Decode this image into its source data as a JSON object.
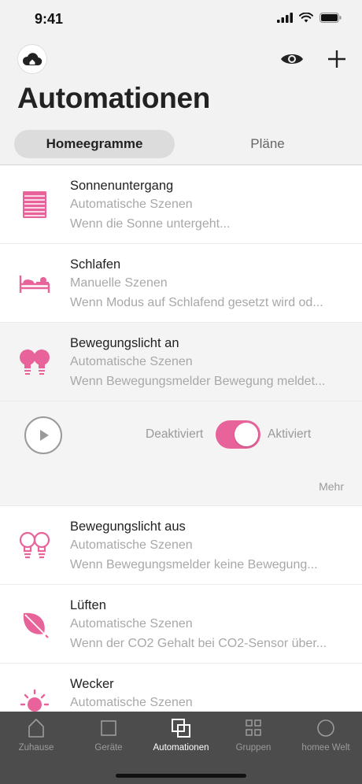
{
  "status_bar": {
    "time": "9:41"
  },
  "header": {
    "title": "Automationen"
  },
  "segments": [
    {
      "label": "Homeegramme",
      "active": true
    },
    {
      "label": "Pläne",
      "active": false
    }
  ],
  "automations": [
    {
      "title": "Sonnenuntergang",
      "type": "Automatische Szenen",
      "description": "Wenn die Sonne untergeht...",
      "icon": "blinds-icon"
    },
    {
      "title": "Schlafen",
      "type": "Manuelle Szenen",
      "description": "Wenn Modus auf Schlafend gesetzt wird od...",
      "icon": "bed-icon"
    },
    {
      "title": "Bewegungslicht an",
      "type": "Automatische Szenen",
      "description": "Wenn Bewegungsmelder Bewegung meldet...",
      "icon": "bulbs-filled-icon"
    },
    {
      "title": "Bewegungslicht aus",
      "type": "Automatische Szenen",
      "description": "Wenn Bewegungsmelder keine Bewegung...",
      "icon": "bulbs-outline-icon"
    },
    {
      "title": "Lüften",
      "type": "Automatische Szenen",
      "description": "Wenn der CO2 Gehalt bei CO2-Sensor über...",
      "icon": "leaf-icon"
    },
    {
      "title": "Wecker",
      "type": "Automatische Szenen",
      "description": "",
      "icon": "sun-icon"
    }
  ],
  "expanded_panel": {
    "off_label": "Deaktiviert",
    "on_label": "Aktiviert",
    "more_label": "Mehr",
    "toggle_on": true
  },
  "tabs": [
    {
      "label": "Zuhause",
      "icon": "house-icon",
      "active": false
    },
    {
      "label": "Geräte",
      "icon": "square-icon",
      "active": false
    },
    {
      "label": "Automationen",
      "icon": "overlapping-squares-icon",
      "active": true
    },
    {
      "label": "Gruppen",
      "icon": "grid-icon",
      "active": false
    },
    {
      "label": "homee Welt",
      "icon": "circle-icon",
      "active": false
    }
  ],
  "colors": {
    "accent": "#e8639a",
    "tabbar": "#4c4c4c",
    "background": "#f2f2f2"
  }
}
